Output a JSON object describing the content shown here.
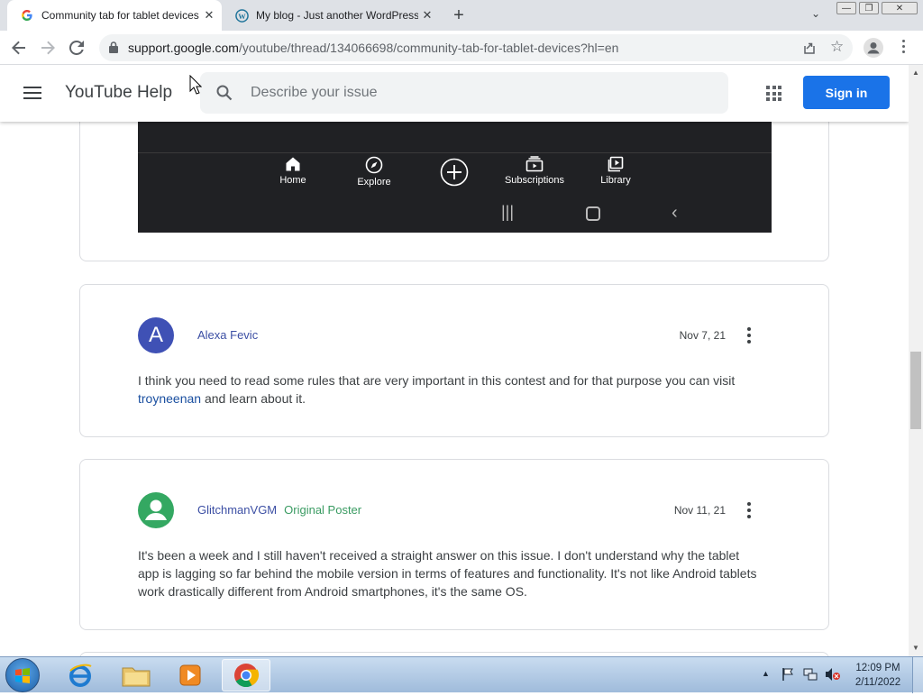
{
  "browser": {
    "tabs": [
      {
        "title": "Community tab for tablet devices",
        "active": true
      },
      {
        "title": "My blog - Just another WordPress",
        "active": false
      }
    ],
    "url_host": "support.google.com",
    "url_path": "/youtube/thread/134066698/community-tab-for-tablet-devices?hl=en"
  },
  "header": {
    "title": "YouTube Help",
    "search_placeholder": "Describe your issue",
    "signin_label": "Sign in"
  },
  "mockup_nav": [
    {
      "label": "Home",
      "icon": "home-icon"
    },
    {
      "label": "Explore",
      "icon": "compass-icon"
    },
    {
      "label": "",
      "icon": "create-plus-icon"
    },
    {
      "label": "Subscriptions",
      "icon": "subscriptions-icon"
    },
    {
      "label": "Library",
      "icon": "library-icon"
    }
  ],
  "replies": [
    {
      "avatar_letter": "A",
      "avatar_color": "#3f51b5",
      "author": "Alexa Fevic",
      "badge": "",
      "date": "Nov 7, 21",
      "text_before": "I think you need to read some rules that are very important in this contest and for that purpose you can visit ",
      "link": "troyneenan",
      "text_after": " and learn about it."
    },
    {
      "avatar_color": "#34a862",
      "author": "GlitchmanVGM",
      "badge": "Original Poster",
      "date": "Nov 11, 21",
      "text": "It's been a week and I still haven't received a straight answer on this issue. I don't understand why the tablet app is lagging so far behind the mobile version in terms of features and functionality. It's not like Android tablets work drastically different from Android smartphones, it's the same OS."
    }
  ],
  "taskbar": {
    "time": "12:09 PM",
    "date": "2/11/2022"
  }
}
